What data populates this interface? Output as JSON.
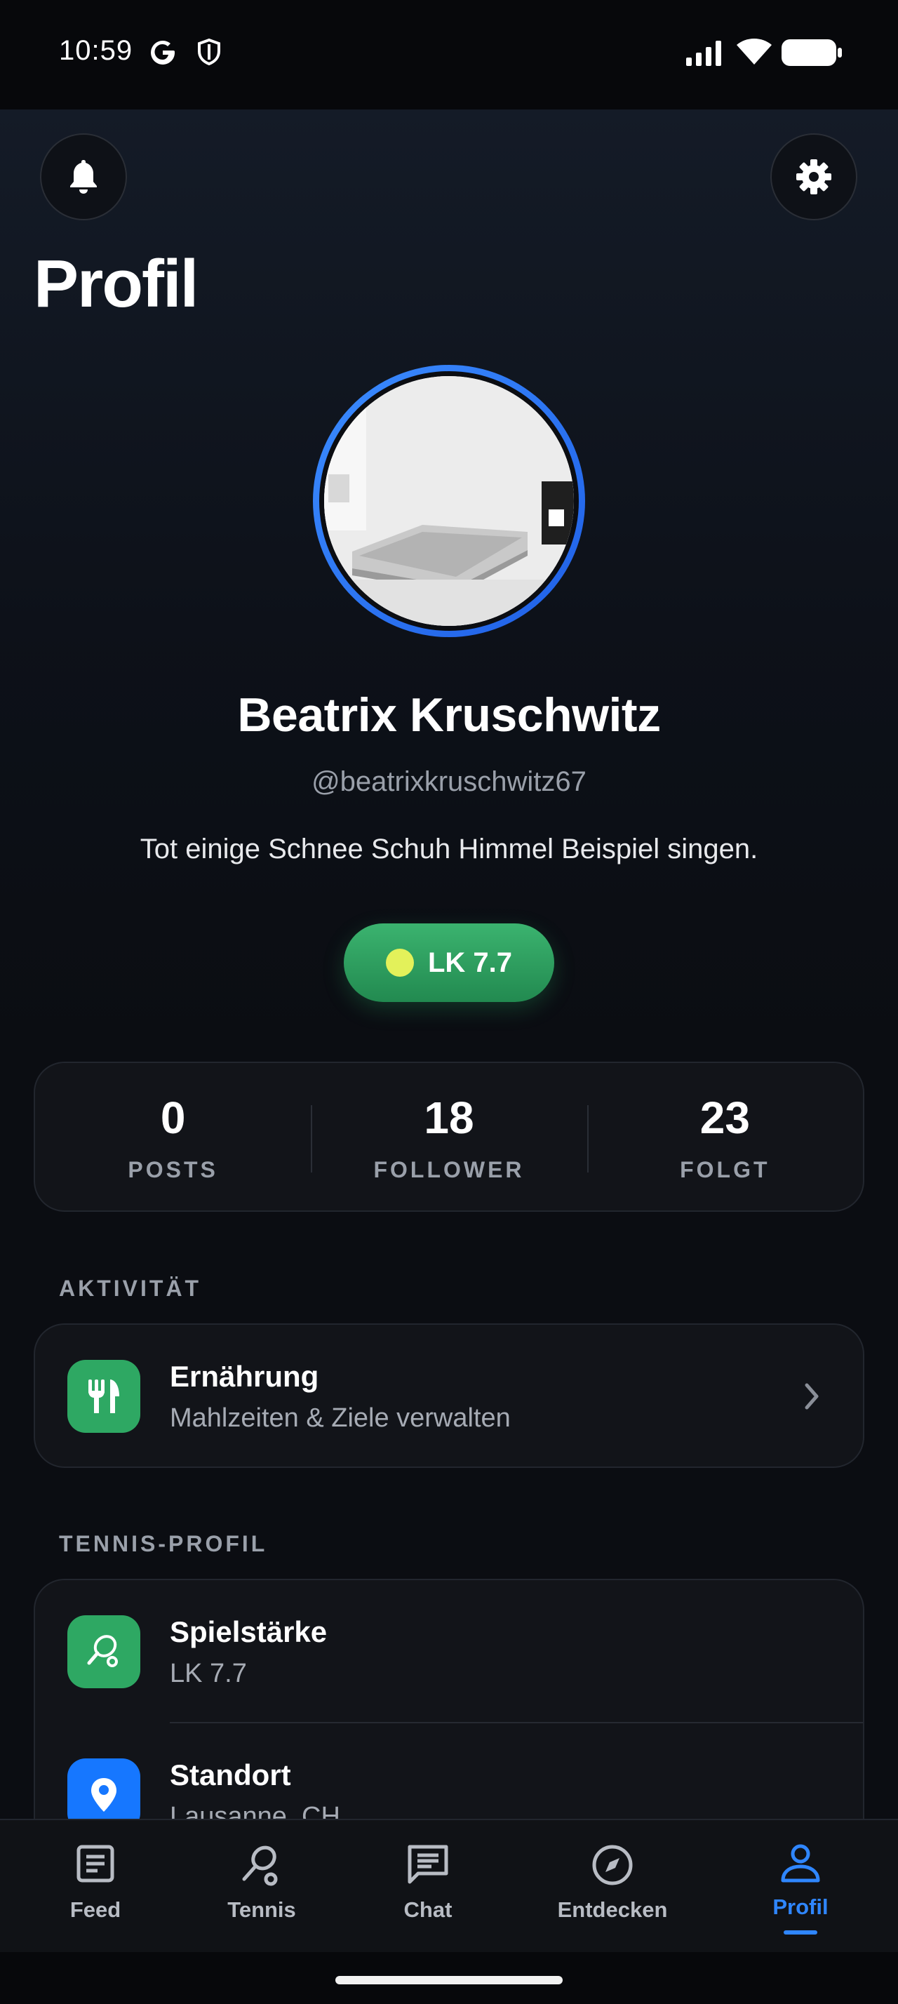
{
  "status_bar": {
    "time": "10:59"
  },
  "header": {
    "title": "Profil"
  },
  "profile": {
    "name": "Beatrix Kruschwitz",
    "handle": "@beatrixkruschwitz67",
    "bio": "Tot einige Schnee Schuh Himmel Beispiel singen.",
    "badge": "LK 7.7"
  },
  "stats": [
    {
      "value": "0",
      "label": "POSTS"
    },
    {
      "value": "18",
      "label": "FOLLOWER"
    },
    {
      "value": "23",
      "label": "FOLGT"
    }
  ],
  "activity": {
    "section_label": "AKTIVITÄT",
    "items": [
      {
        "title": "Ernährung",
        "subtitle": "Mahlzeiten & Ziele verwalten",
        "icon": "fork-knife-icon"
      }
    ]
  },
  "tennis_profile": {
    "section_label": "TENNIS-PROFIL",
    "items": [
      {
        "title": "Spielstärke",
        "subtitle": "LK 7.7",
        "icon": "racket-icon"
      },
      {
        "title": "Standort",
        "subtitle": "Lausanne, CH",
        "icon": "location-pin-icon"
      }
    ]
  },
  "bottom_nav": {
    "items": [
      {
        "label": "Feed",
        "icon": "feed-icon"
      },
      {
        "label": "Tennis",
        "icon": "racket-icon"
      },
      {
        "label": "Chat",
        "icon": "chat-icon"
      },
      {
        "label": "Entdecken",
        "icon": "compass-icon"
      },
      {
        "label": "Profil",
        "icon": "person-icon",
        "active": true
      }
    ]
  },
  "colors": {
    "accent": "#2f86ff",
    "badge_green": "#2ea863",
    "background": "#0b0d12"
  }
}
